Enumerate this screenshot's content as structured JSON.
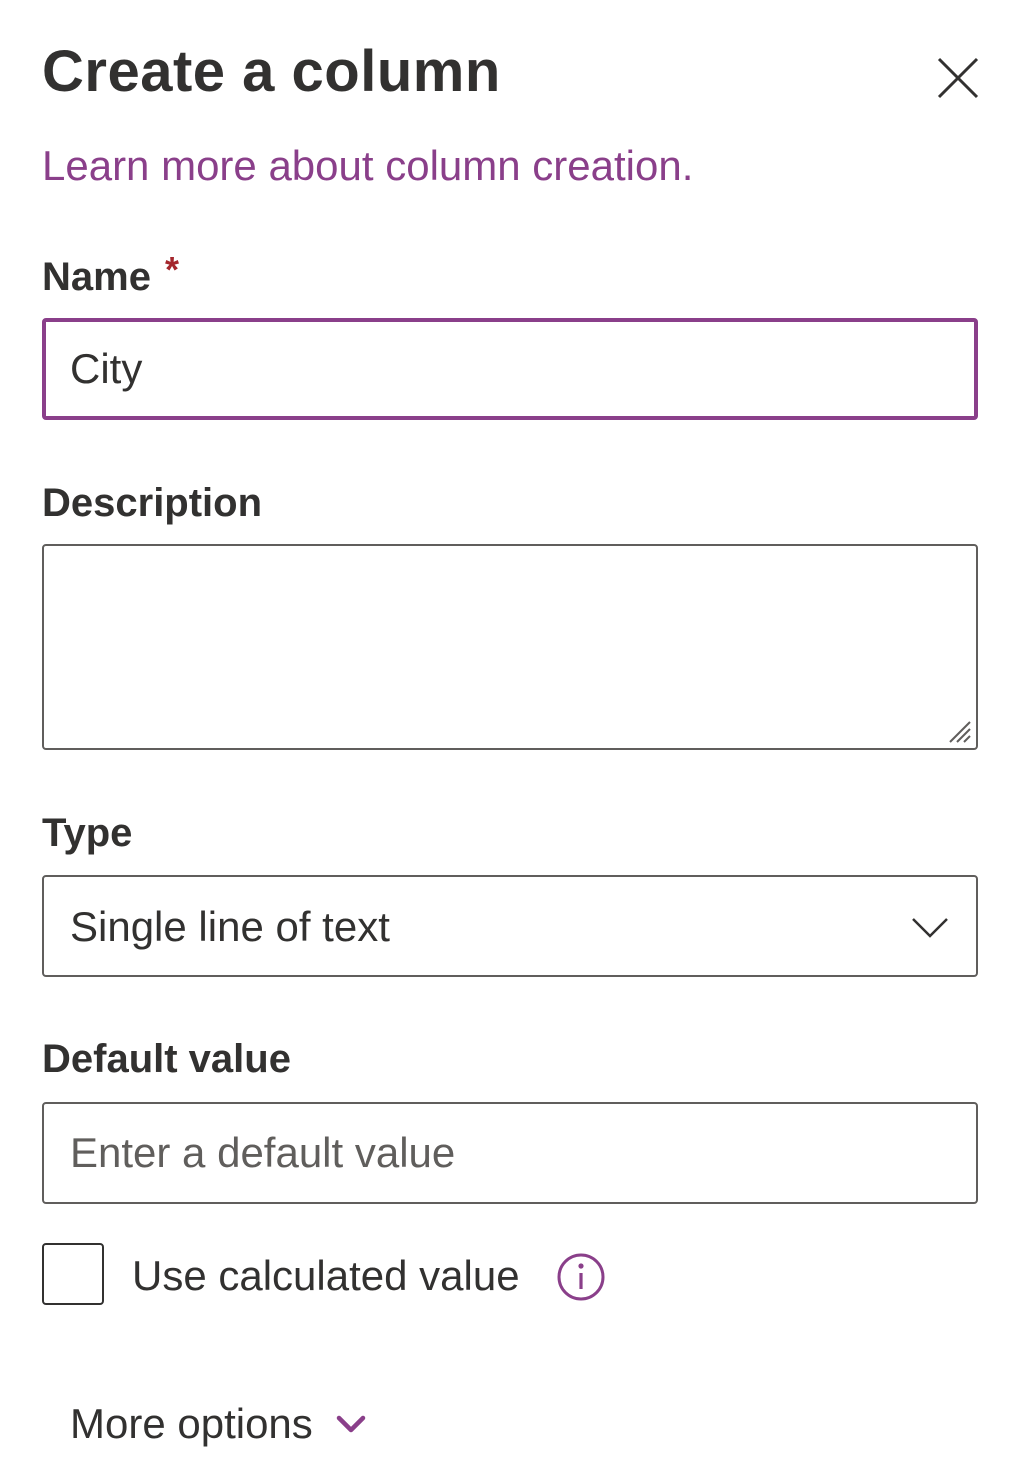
{
  "panel": {
    "title": "Create a column",
    "close_icon": "close-icon",
    "learn_more_link": "Learn more about column creation."
  },
  "fields": {
    "name": {
      "label": "Name",
      "required_marker": "*",
      "value": "City"
    },
    "description": {
      "label": "Description",
      "value": ""
    },
    "type": {
      "label": "Type",
      "selected": "Single line of text",
      "icon": "chevron-down-icon"
    },
    "default_value": {
      "label": "Default value",
      "placeholder": "Enter a default value",
      "value": ""
    },
    "use_calculated": {
      "label": "Use calculated value",
      "checked": false,
      "icon": "info-icon"
    }
  },
  "more_options": {
    "label": "More options",
    "icon": "chevron-down-icon"
  },
  "colors": {
    "accent": "#8a3f8a",
    "required": "#a4262c",
    "text": "#323130",
    "border": "#605e5c"
  }
}
